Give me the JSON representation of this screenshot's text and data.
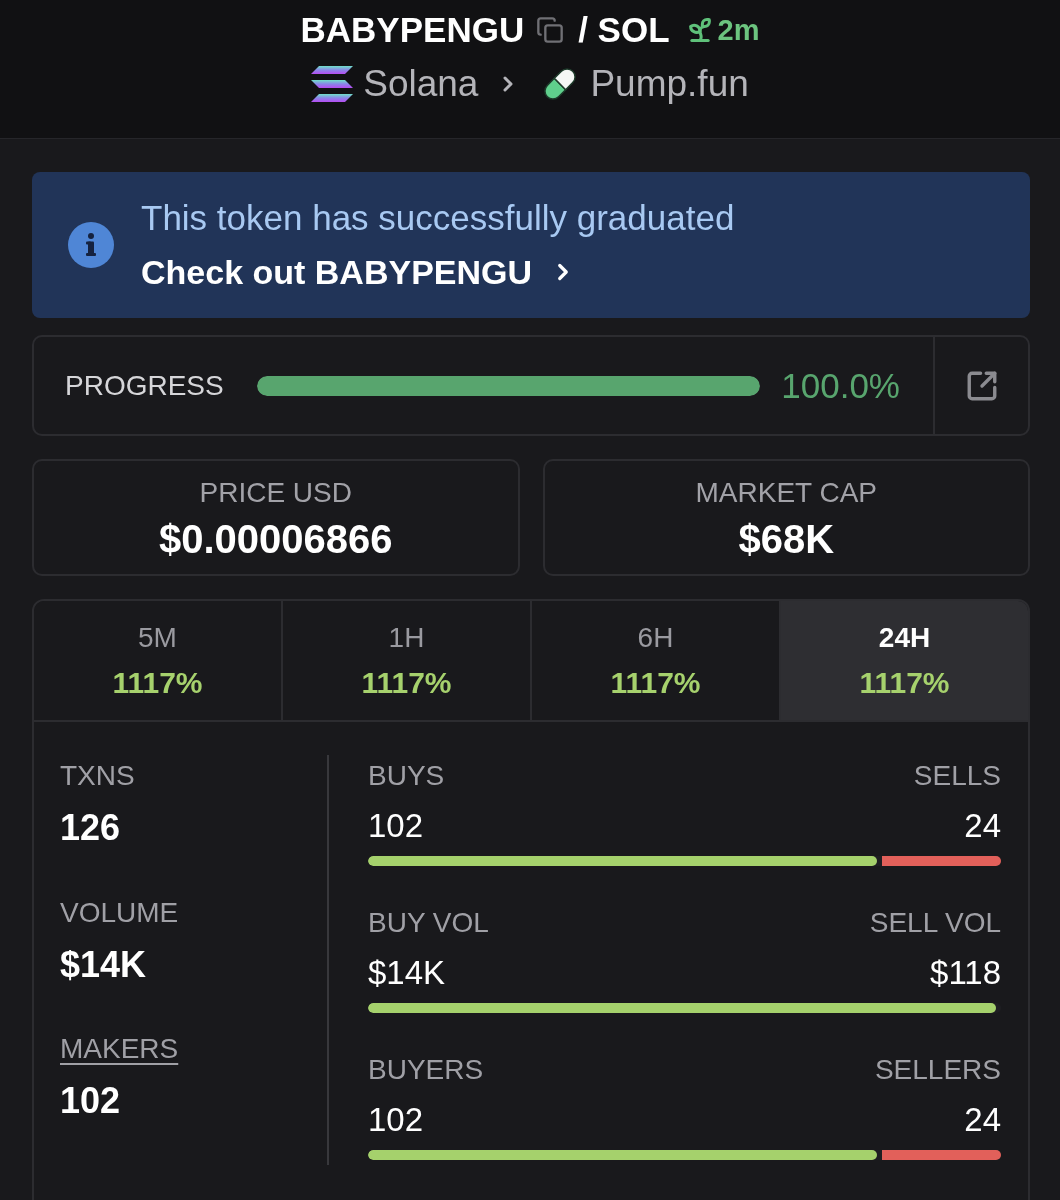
{
  "header": {
    "token": "BABYPENGU",
    "pair": "/ SOL",
    "age": "2m",
    "chain": "Solana",
    "platform": "Pump.fun"
  },
  "banner": {
    "message": "This token has successfully graduated",
    "link": "Check out BABYPENGU"
  },
  "progress": {
    "label": "PROGRESS",
    "level": 1,
    "reading": "100.0%"
  },
  "prices": [
    {
      "label": "PRICE USD",
      "value": "$0.00006866"
    },
    {
      "label": "MARKET CAP",
      "value": "$68K"
    }
  ],
  "tabs": [
    {
      "label": "5M",
      "change": "1117%",
      "selected": false
    },
    {
      "label": "1H",
      "change": "1117%",
      "selected": false
    },
    {
      "label": "6H",
      "change": "1117%",
      "selected": false
    },
    {
      "label": "24H",
      "change": "1117%",
      "selected": true
    }
  ],
  "stats": [
    {
      "label": "TXNS",
      "value": "126",
      "underlined": false
    },
    {
      "label": "VOLUME",
      "value": "$14K",
      "underlined": false
    },
    {
      "label": "MAKERS",
      "value": "102",
      "underlined": true
    }
  ],
  "ratios": [
    {
      "left_label": "BUYS",
      "left_value": "102",
      "right_label": "SELLS",
      "right_value": "24",
      "level": 0.81
    },
    {
      "left_label": "BUY VOL",
      "left_value": "$14K",
      "right_label": "SELL VOL",
      "right_value": "$118",
      "level": 1
    },
    {
      "left_label": "BUYERS",
      "left_value": "102",
      "right_label": "SELLERS",
      "right_value": "24",
      "level": 0.81
    }
  ]
}
